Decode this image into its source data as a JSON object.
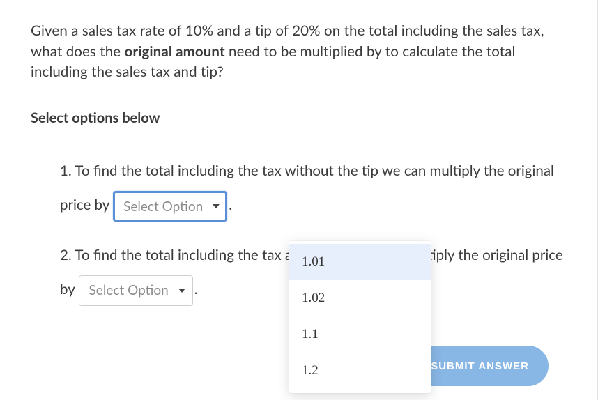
{
  "question": {
    "pre": "Given a sales tax rate of ",
    "tax_rate": "10%",
    "mid1": " and a tip of ",
    "tip_rate": "20%",
    "mid2": " on the total including the sales tax, what does the ",
    "bold": "original amount",
    "post": " need to be multiplied by to calculate the total including the sales tax and tip?"
  },
  "instruction": "Select options below",
  "items": [
    {
      "num": "1.",
      "text_before": " To find the total including the tax without the tip we can multiply the original price by ",
      "select_placeholder": "Select Option",
      "text_after": ".",
      "active": true
    },
    {
      "num": "2.",
      "text_before": " To find the total including the tax and the tip we can multiply the original price by ",
      "select_placeholder": "Select Option",
      "text_after": ".",
      "active": false
    }
  ],
  "dropdown": {
    "options": [
      "1.01",
      "1.02",
      "1.1",
      "1.2"
    ],
    "highlighted_index": 0
  },
  "submit_label": "SUBMIT ANSWER"
}
